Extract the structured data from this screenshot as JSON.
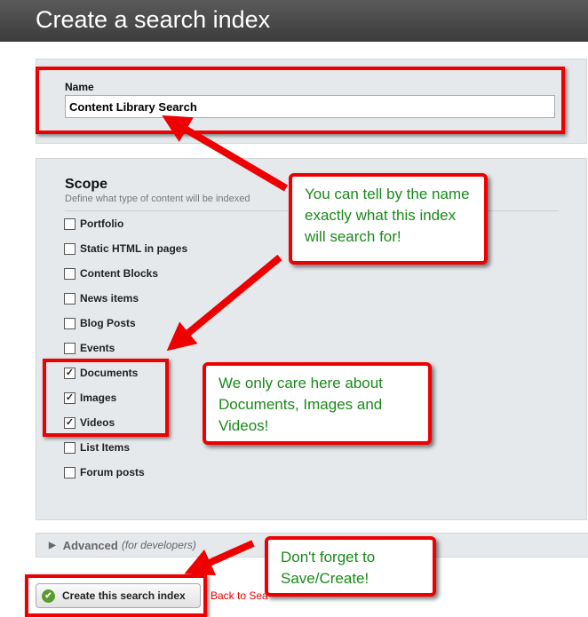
{
  "header": {
    "title": "Create a search index"
  },
  "name_section": {
    "label": "Name",
    "value": "Content Library Search"
  },
  "scope": {
    "title": "Scope",
    "description": "Define what type of content will be indexed",
    "items": [
      {
        "label": "Portfolio",
        "checked": false
      },
      {
        "label": "Static HTML in pages",
        "checked": false
      },
      {
        "label": "Content Blocks",
        "checked": false
      },
      {
        "label": "News items",
        "checked": false
      },
      {
        "label": "Blog Posts",
        "checked": false
      },
      {
        "label": "Events",
        "checked": false
      },
      {
        "label": "Documents",
        "checked": true
      },
      {
        "label": "Images",
        "checked": true
      },
      {
        "label": "Videos",
        "checked": true
      },
      {
        "label": "List Items",
        "checked": false
      },
      {
        "label": "Forum posts",
        "checked": false
      }
    ]
  },
  "advanced": {
    "label": "Advanced",
    "hint": "(for developers)"
  },
  "actions": {
    "create_label": "Create this search index",
    "back_label": "Back to Sea"
  },
  "callouts": [
    "You can tell by the name exactly what this index will search for!",
    "We only care here about Documents, Images and Videos!",
    "Don't forget to Save/Create!"
  ],
  "colors": {
    "annotation": "#e00000",
    "callout_text": "#1a8a1a"
  }
}
